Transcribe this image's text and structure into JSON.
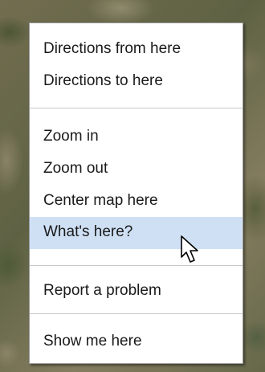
{
  "context_menu": {
    "items": [
      {
        "label": "Directions from here"
      },
      {
        "label": "Directions to here"
      },
      {
        "label": "Zoom in"
      },
      {
        "label": "Zoom out"
      },
      {
        "label": "Center map here"
      },
      {
        "label": "What's here?",
        "highlighted": true
      },
      {
        "label": "Report a problem"
      },
      {
        "label": "Show me here"
      }
    ]
  },
  "colors": {
    "highlight": "#cfe0f4",
    "menu_background": "#ffffff",
    "separator": "#c8c8c8",
    "text": "#1a1a1a"
  },
  "icons": {
    "cursor": "mouse-pointer-icon",
    "background": "satellite-map"
  }
}
